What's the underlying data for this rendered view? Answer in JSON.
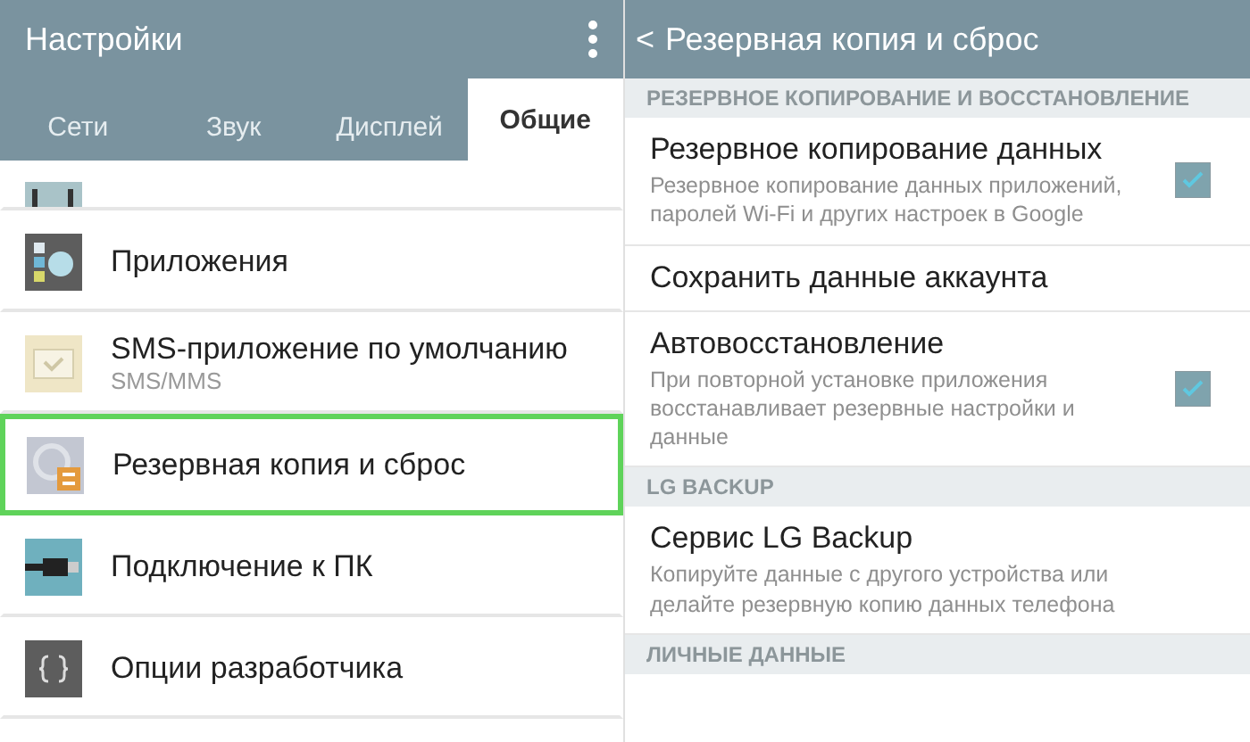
{
  "left": {
    "title": "Настройки",
    "tabs": [
      {
        "label": "Сети",
        "selected": false
      },
      {
        "label": "Звук",
        "selected": false
      },
      {
        "label": "Дисплей",
        "selected": false
      },
      {
        "label": "Общие",
        "selected": true
      }
    ],
    "items": [
      {
        "kind": "partial",
        "selected": false
      },
      {
        "kind": "apps",
        "title": "Приложения",
        "selected": false
      },
      {
        "kind": "sms",
        "title": "SMS-приложение по умолчанию",
        "subtitle": "SMS/MMS",
        "selected": false
      },
      {
        "kind": "backup",
        "title": "Резервная копия и сброс",
        "selected": true
      },
      {
        "kind": "usb",
        "title": "Подключение к ПК",
        "selected": false
      },
      {
        "kind": "dev",
        "title": "Опции разработчика",
        "selected": false
      }
    ]
  },
  "right": {
    "title": "Резервная копия и сброс",
    "back": "<",
    "rows": [
      {
        "kind": "header",
        "title": "РЕЗЕРВНОЕ КОПИРОВАНИЕ И ВОССТАНОВЛЕНИЕ"
      },
      {
        "kind": "check",
        "title": "Резервное копирование данных",
        "subtitle": "Резервное копирование данных приложений, паролей Wi-Fi и других настроек в Google",
        "checked": true
      },
      {
        "kind": "item",
        "title": "Сохранить данные аккаунта"
      },
      {
        "kind": "check",
        "title": "Автовосстановление",
        "subtitle": "При повторной установке приложения восстанавливает резервные настройки и данные",
        "checked": true
      },
      {
        "kind": "header",
        "title": "LG BACKUP"
      },
      {
        "kind": "item",
        "title": "Сервис LG Backup",
        "subtitle": "Копируйте данные с другого устройства или делайте резервную копию данных телефона"
      },
      {
        "kind": "header",
        "title": "ЛИЧНЫЕ ДАННЫЕ"
      }
    ]
  }
}
